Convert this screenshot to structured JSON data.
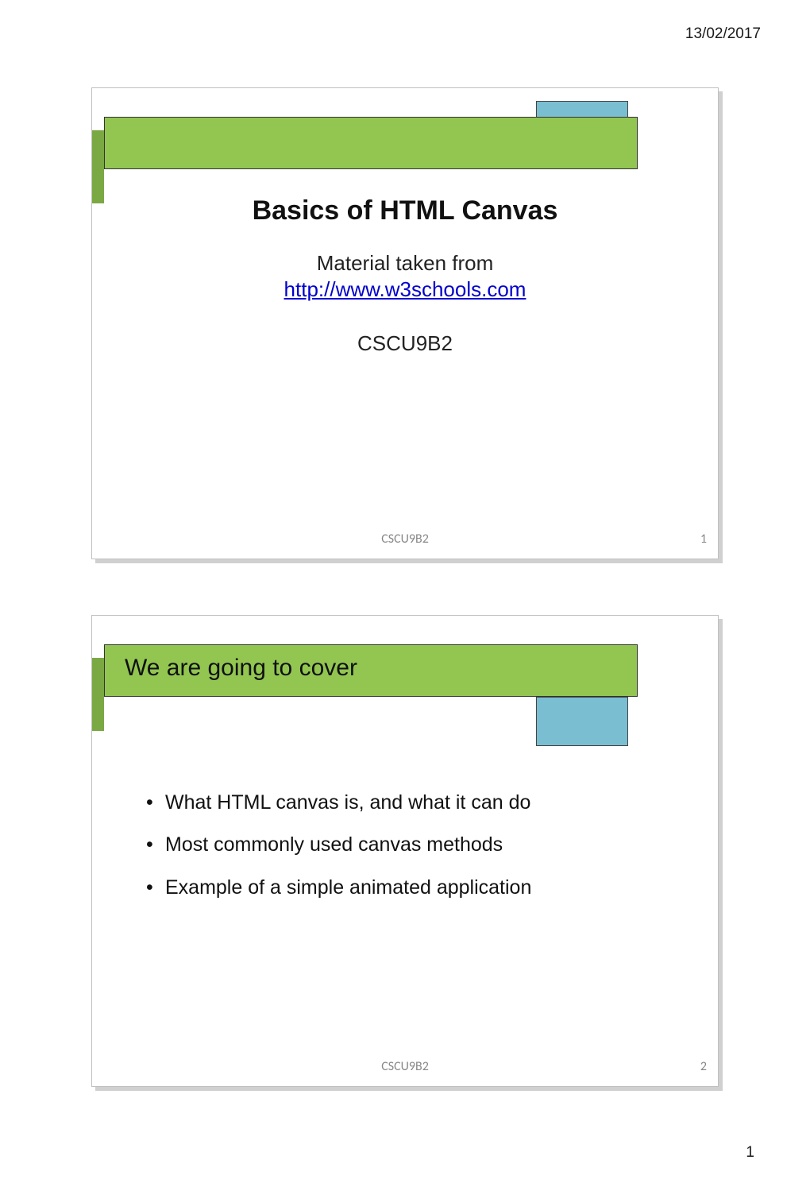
{
  "page": {
    "header_date": "13/02/2017",
    "footer_page_number": "1"
  },
  "slides": [
    {
      "title": "Basics of HTML Canvas",
      "subtitle_line1": "Material taken from",
      "subtitle_link": "http://www.w3schools.com",
      "course_code": "CSCU9B2",
      "footer_center": "CSCU9B2",
      "footer_slide_number": "1"
    },
    {
      "bar_title": "We are going to cover",
      "bullets": [
        "What HTML canvas is, and what it can do",
        "Most commonly used canvas methods",
        "Example of a simple animated application"
      ],
      "footer_center": "CSCU9B2",
      "footer_slide_number": "2"
    }
  ]
}
